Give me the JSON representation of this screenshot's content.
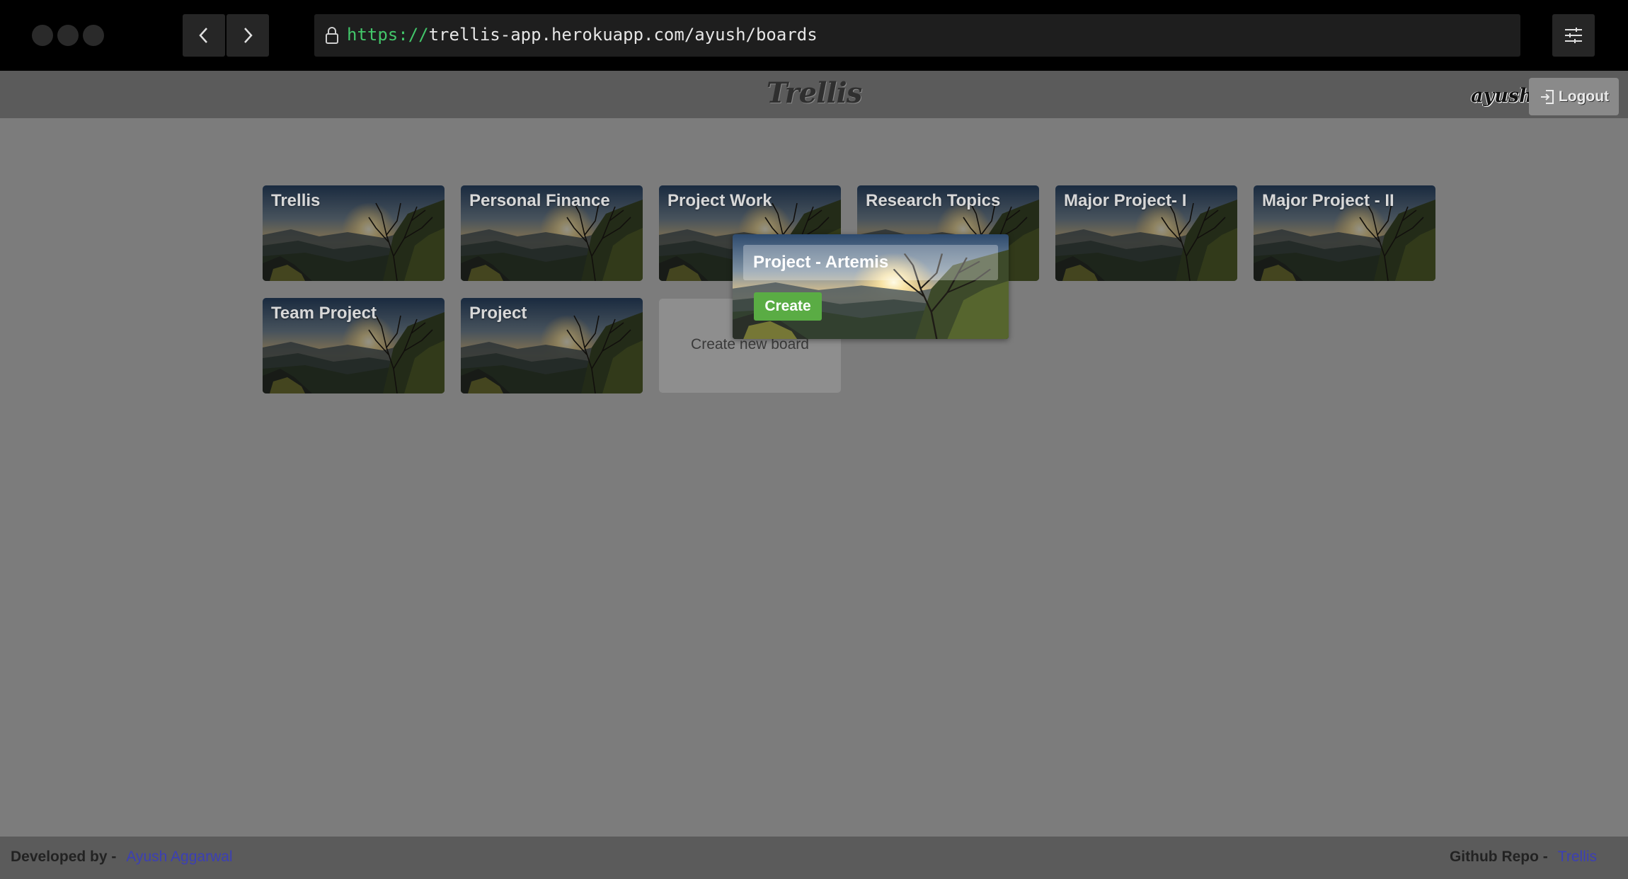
{
  "browser": {
    "url_protocol": "https://",
    "url_rest": "trellis-app.herokuapp.com/ayush/boards"
  },
  "header": {
    "brand": "Trellis",
    "username": "ayush",
    "logout_label": "Logout"
  },
  "boards": [
    {
      "title": "Trellis"
    },
    {
      "title": "Personal Finance"
    },
    {
      "title": "Project Work"
    },
    {
      "title": "Research Topics"
    },
    {
      "title": "Major Project- I"
    },
    {
      "title": "Major Project - II"
    },
    {
      "title": "Team Project"
    },
    {
      "title": "Project"
    }
  ],
  "create_board": {
    "label": "Create new board"
  },
  "popup": {
    "input_value": "Project - Artemis",
    "create_label": "Create"
  },
  "footer": {
    "developed_by_label": "Developed by -",
    "developer_name": "Ayush Aggarwal",
    "repo_label": "Github Repo -",
    "repo_name": "Trellis"
  },
  "colors": {
    "create_button": "#5aac44",
    "url_protocol": "#43c66a",
    "footer_link": "#3b3fb5"
  }
}
